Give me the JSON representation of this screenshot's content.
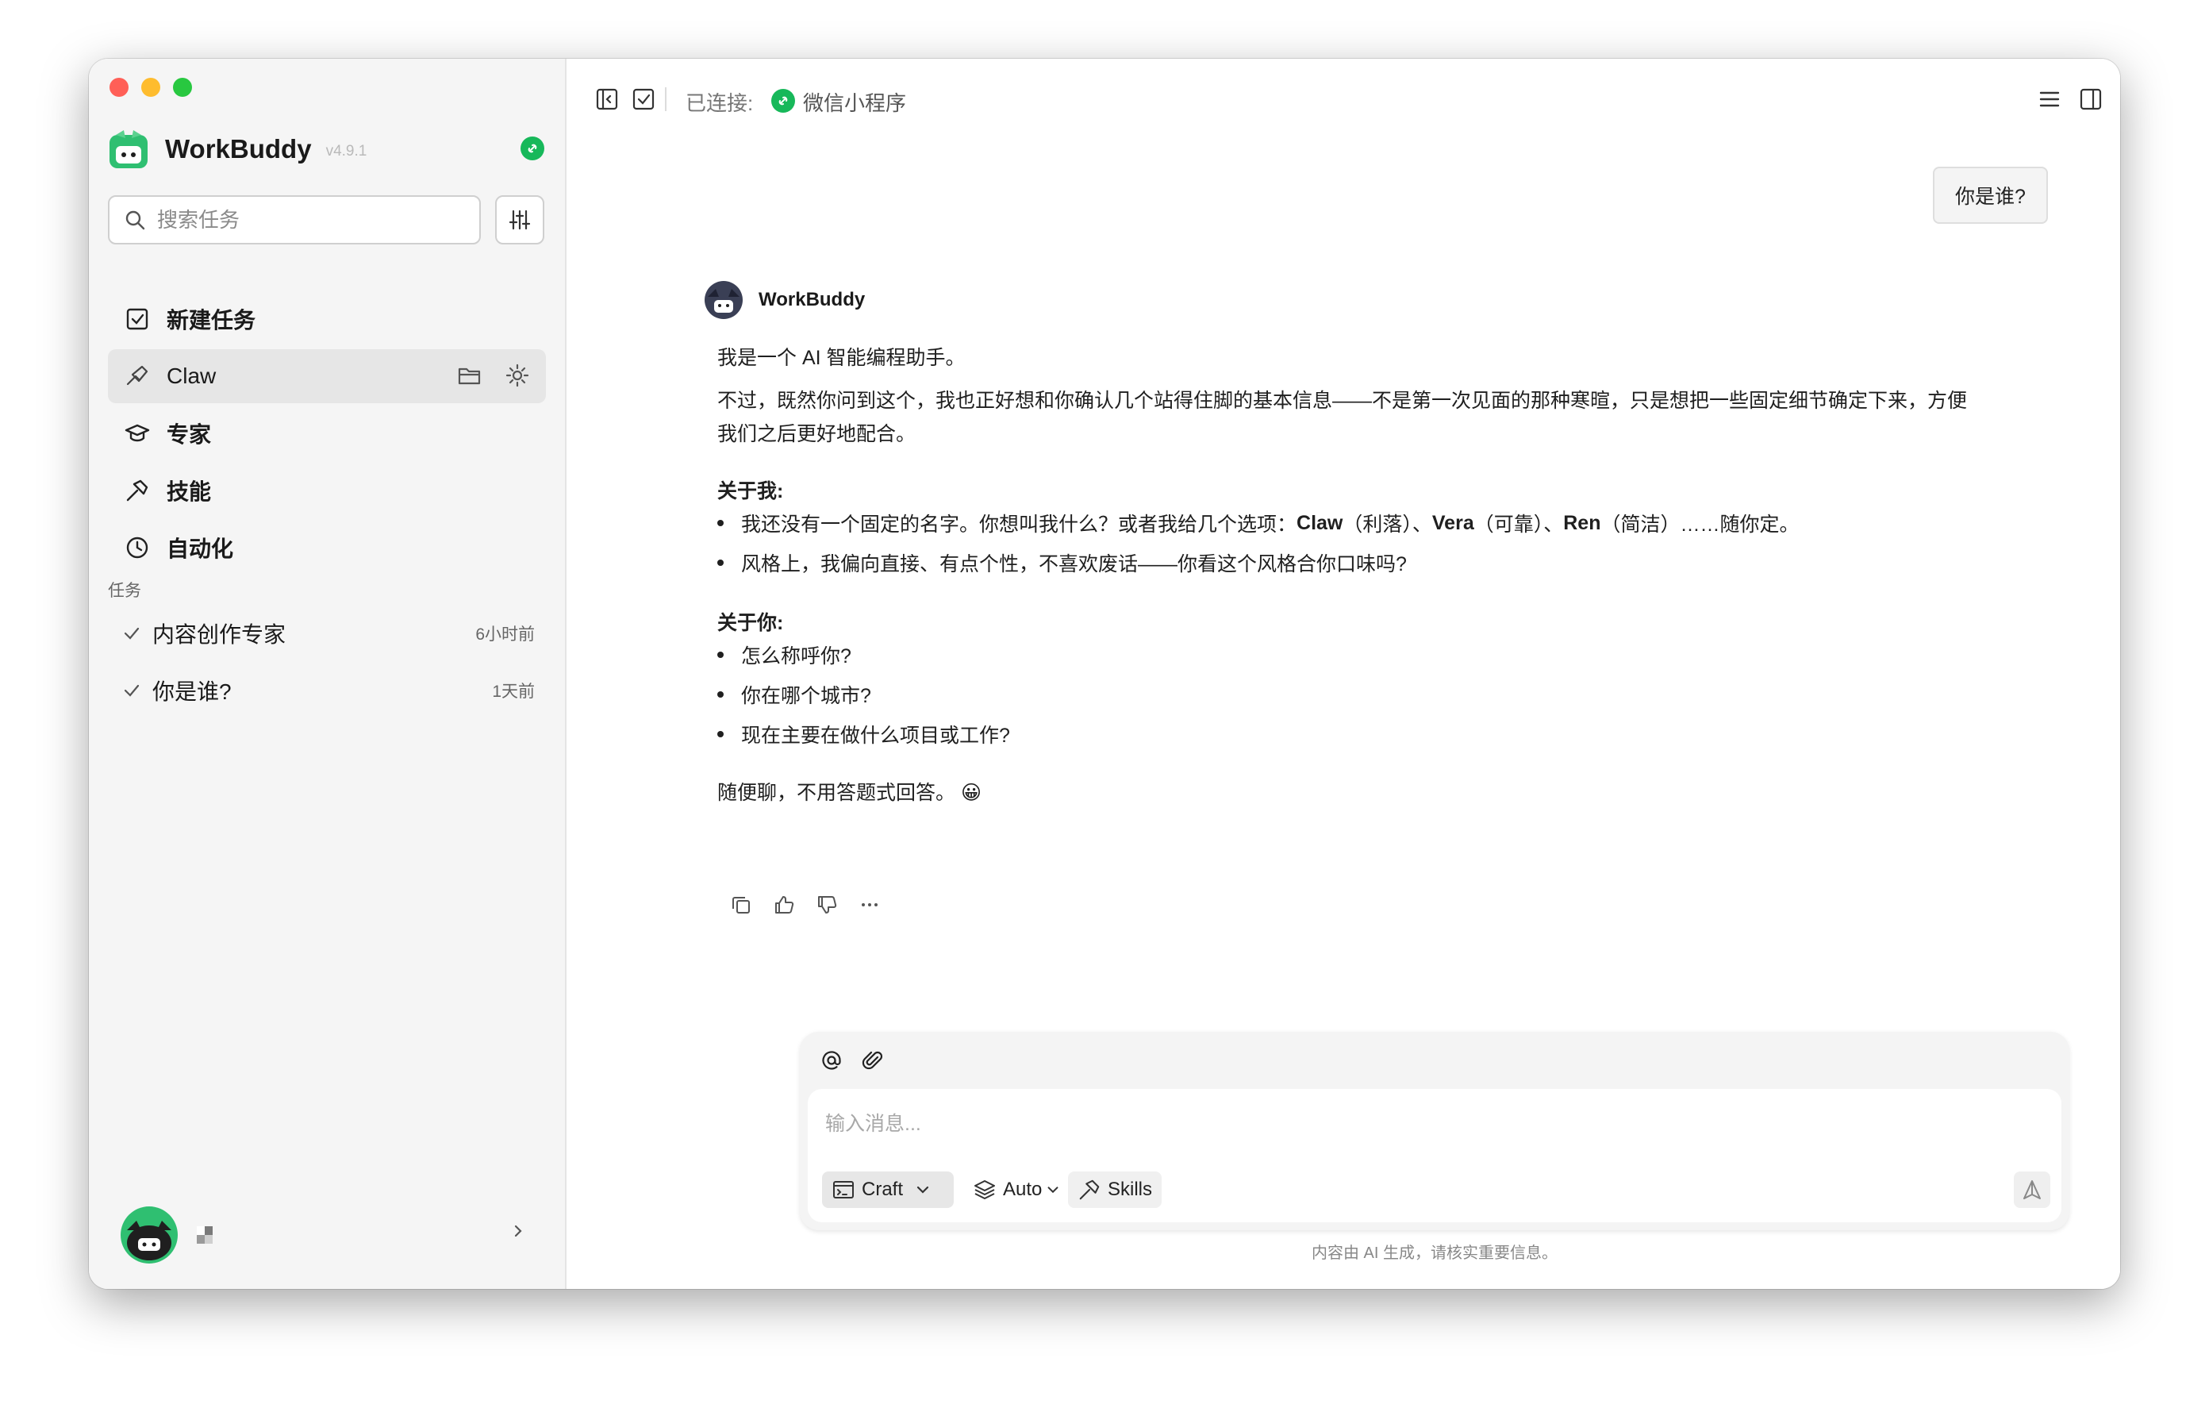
{
  "app": {
    "name": "WorkBuddy",
    "version": "v4.9.1"
  },
  "sidebar": {
    "search_placeholder": "搜索任务",
    "nav": [
      {
        "label": "新建任务",
        "icon": "new-task-icon"
      },
      {
        "label": "Claw",
        "icon": "claw-icon"
      },
      {
        "label": "专家",
        "icon": "expert-icon"
      },
      {
        "label": "技能",
        "icon": "skills-icon"
      },
      {
        "label": "自动化",
        "icon": "clock-icon"
      }
    ],
    "tasks_section_label": "任务",
    "tasks": [
      {
        "title": "内容创作专家",
        "time": "6小时前"
      },
      {
        "title": "你是谁?",
        "time": "1天前"
      }
    ]
  },
  "topbar": {
    "connected_label": "已连接:",
    "connected_target": "微信小程序"
  },
  "conversation": {
    "user_message": "你是谁?",
    "bot_name": "WorkBuddy",
    "intro": "我是一个 AI 智能编程助手。",
    "para": "不过，既然你问到这个，我也正好想和你确认几个站得住脚的基本信息——不是第一次见面的那种寒暄，只是想把一些固定细节确定下来，方便我们之后更好地配合。",
    "about_me_title": "关于我:",
    "about_me": {
      "b1_pre": "我还没有一个固定的名字。你想叫我什么？或者我给几个选项：",
      "opt1": "Claw",
      "opt1_note": "（利落）、",
      "opt2": "Vera",
      "opt2_note": "（可靠）、",
      "opt3": "Ren",
      "opt3_note": "（简洁）……随你定。",
      "b2": "风格上，我偏向直接、有点个性，不喜欢废话——你看这个风格合你口味吗?"
    },
    "about_you_title": "关于你:",
    "about_you": [
      "怎么称呼你?",
      "你在哪个城市?",
      "现在主要在做什么项目或工作?"
    ],
    "closing": "随便聊，不用答题式回答。",
    "closing_emoji": "😀"
  },
  "composer": {
    "placeholder": "输入消息...",
    "mode": "Craft",
    "model": "Auto",
    "skills": "Skills",
    "disclaimer": "内容由 AI 生成，请核实重要信息。"
  },
  "colors": {
    "accent_green": "#17b85a",
    "sidebar_bg": "#f5f5f5",
    "active_item_bg": "#e6e6e6"
  }
}
